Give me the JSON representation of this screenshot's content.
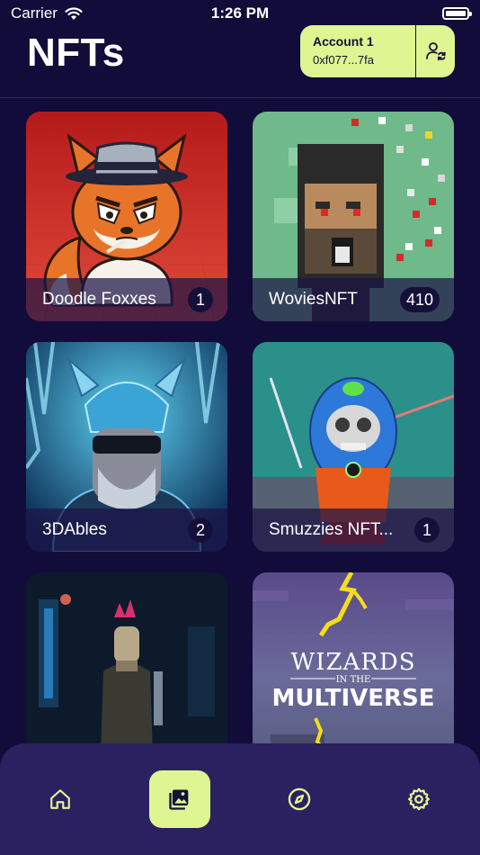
{
  "status_bar": {
    "carrier": "Carrier",
    "time": "1:26 PM"
  },
  "header": {
    "title": "NFTs"
  },
  "account": {
    "name": "Account 1",
    "address": "0xf077...7fa"
  },
  "collections": [
    {
      "name": "Doodle Foxxes",
      "count": "1"
    },
    {
      "name": "WoviesNFT",
      "count": "410"
    },
    {
      "name": "3DAbles",
      "count": "2"
    },
    {
      "name": "Smuzzies NFT...",
      "count": "1"
    },
    {
      "name": "",
      "count": ""
    },
    {
      "name": "",
      "count": ""
    }
  ],
  "wizards_art": {
    "line1": "WIZARDS",
    "line2": "IN THE",
    "line3": "MULTIVERSE"
  },
  "nav": {
    "items": [
      {
        "icon": "home-icon"
      },
      {
        "icon": "gallery-icon",
        "active": true
      },
      {
        "icon": "compass-icon"
      },
      {
        "icon": "gear-icon"
      }
    ]
  },
  "colors": {
    "background": "#120c3a",
    "accent": "#dff591",
    "nav_bg": "#2b2060"
  }
}
